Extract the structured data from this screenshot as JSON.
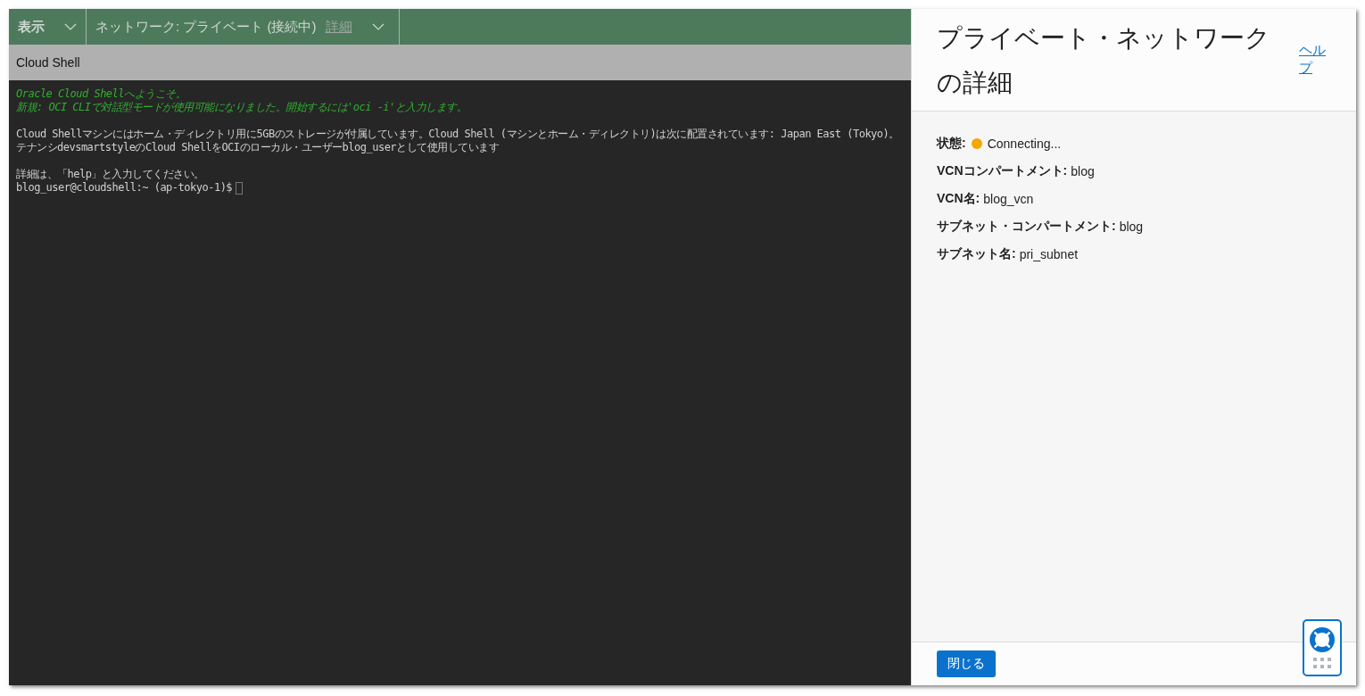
{
  "toolbar": {
    "menus": [
      {
        "label": "表示"
      },
      {
        "label": "ネットワーク: プライベート (接続中)",
        "detail_link": "詳細"
      }
    ]
  },
  "shell_title": "Cloud Shell",
  "terminal": {
    "lines": [
      {
        "kind": "notice",
        "text": "Oracle Cloud Shellへようこそ。"
      },
      {
        "kind": "notice",
        "text": "新規: OCI CLIで対話型モードが使用可能になりました。開始するには'oci -i'と入力します。"
      },
      {
        "kind": "blank"
      },
      {
        "kind": "plain",
        "text": "Cloud Shellマシンにはホーム・ディレクトリ用に5GBのストレージが付属しています。Cloud Shell (マシンとホーム・ディレクトリ)は次に配置されています: Japan East (Tokyo)。"
      },
      {
        "kind": "plain",
        "text": "テナンシdevsmartstyleのCloud ShellをOCIのローカル・ユーザーblog_userとして使用しています"
      },
      {
        "kind": "blank"
      },
      {
        "kind": "plain",
        "text": "詳細は、「help」と入力してください。"
      },
      {
        "kind": "prompt",
        "text": "blog_user@cloudshell:~ (ap-tokyo-1)$"
      }
    ]
  },
  "panel": {
    "title": "プライベート・ネットワークの詳細",
    "help_link": "ヘルプ",
    "fields": [
      {
        "label": "状態:",
        "value": "Connecting...",
        "color": "#f5a700"
      },
      {
        "label": "VCNコンパートメント:",
        "value": "blog"
      },
      {
        "label": "VCN名:",
        "value": "blog_vcn"
      },
      {
        "label": "サブネット・コンパートメント:",
        "value": "blog"
      },
      {
        "label": "サブネット名:",
        "value": "pri_subnet"
      }
    ],
    "close_button": "閉じる"
  }
}
